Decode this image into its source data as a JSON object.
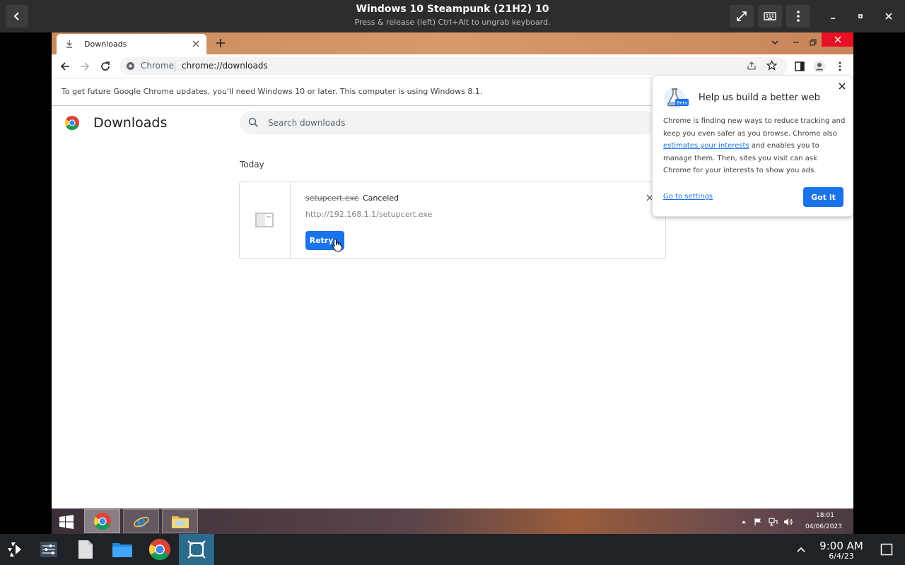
{
  "host": {
    "title": "Windows 10 Steampunk (21H2) 10",
    "subtitle": "Press & release (left) Ctrl+Alt to ungrab keyboard."
  },
  "chrome": {
    "tab_title": "Downloads",
    "omnibox_site": "Chrome",
    "omnibox_url": "chrome://downloads",
    "infobar_text": "To get future Google Chrome updates, you'll need Windows 10 or later. This computer is using Windows 8.1."
  },
  "downloads": {
    "title": "Downloads",
    "search_placeholder": "Search downloads",
    "section": "Today",
    "items": [
      {
        "filename": "setupcert.exe",
        "status": "Canceled",
        "url": "http://192.168.1.1/setupcert.exe",
        "action": "Retry"
      }
    ]
  },
  "bubble": {
    "title": "Help us build a better web",
    "badge": "Beta",
    "body_1": "Chrome is finding new ways to reduce tracking and keep you even safer as you browse. Chrome also ",
    "body_link": "estimates your interests",
    "body_2": " and enables you to manage them. Then, sites you visit can ask Chrome for your interests to show you ads.",
    "settings_link": "Go to settings",
    "ok_button": "Got it"
  },
  "guest_taskbar": {
    "time": "18:01",
    "date": "04/06/2023"
  },
  "host_taskbar": {
    "time": "9:00 AM",
    "date": "6/4/23"
  },
  "colors": {
    "accent": "#1a73e8",
    "host_active": "#2b6a8d",
    "close_red": "#e81123"
  }
}
